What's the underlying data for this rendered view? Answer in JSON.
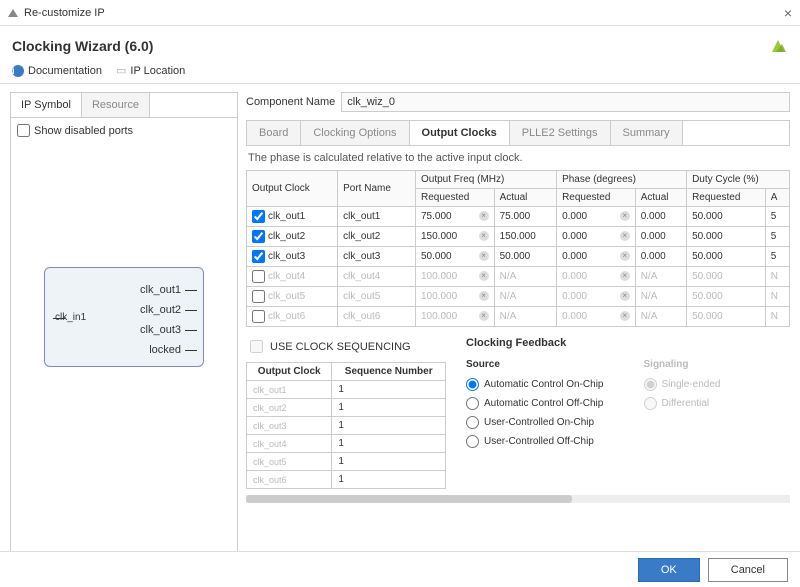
{
  "window_title": "Re-customize IP",
  "page_title": "Clocking Wizard (6.0)",
  "links": {
    "doc": "Documentation",
    "loc": "IP Location"
  },
  "left_tabs": [
    "IP Symbol",
    "Resource"
  ],
  "show_disabled": "Show disabled ports",
  "diagram": {
    "in": "clk_in1",
    "outs": [
      "clk_out1",
      "clk_out2",
      "clk_out3",
      "locked"
    ]
  },
  "comp_label": "Component Name",
  "comp_value": "clk_wiz_0",
  "right_tabs": [
    "Board",
    "Clocking Options",
    "Output Clocks",
    "PLLE2 Settings",
    "Summary"
  ],
  "active_right_tab": 2,
  "note": "The phase is calculated relative to the active input clock.",
  "thead": {
    "oc": "Output Clock",
    "pn": "Port Name",
    "of": "Output Freq (MHz)",
    "ph": "Phase (degrees)",
    "dc": "Duty Cycle (%)",
    "req": "Requested",
    "act": "Actual",
    "a": "A"
  },
  "rows": [
    {
      "en": true,
      "name": "clk_out1",
      "port": "clk_out1",
      "freq_r": "75.000",
      "freq_a": "75.000",
      "ph_r": "0.000",
      "ph_a": "0.000",
      "dc_r": "50.000",
      "dc_a": "5"
    },
    {
      "en": true,
      "name": "clk_out2",
      "port": "clk_out2",
      "freq_r": "150.000",
      "freq_a": "150.000",
      "ph_r": "0.000",
      "ph_a": "0.000",
      "dc_r": "50.000",
      "dc_a": "5"
    },
    {
      "en": true,
      "name": "clk_out3",
      "port": "clk_out3",
      "freq_r": "50.000",
      "freq_a": "50.000",
      "ph_r": "0.000",
      "ph_a": "0.000",
      "dc_r": "50.000",
      "dc_a": "5"
    },
    {
      "en": false,
      "name": "clk_out4",
      "port": "clk_out4",
      "freq_r": "100.000",
      "freq_a": "N/A",
      "ph_r": "0.000",
      "ph_a": "N/A",
      "dc_r": "50.000",
      "dc_a": "N"
    },
    {
      "en": false,
      "name": "clk_out5",
      "port": "clk_out5",
      "freq_r": "100.000",
      "freq_a": "N/A",
      "ph_r": "0.000",
      "ph_a": "N/A",
      "dc_r": "50.000",
      "dc_a": "N"
    },
    {
      "en": false,
      "name": "clk_out6",
      "port": "clk_out6",
      "freq_r": "100.000",
      "freq_a": "N/A",
      "ph_r": "0.000",
      "ph_a": "N/A",
      "dc_r": "50.000",
      "dc_a": "N"
    }
  ],
  "seq_label": "USE CLOCK SEQUENCING",
  "seq_head": {
    "oc": "Output Clock",
    "sn": "Sequence Number"
  },
  "seq_rows": [
    [
      "clk_out1",
      "1"
    ],
    [
      "clk_out2",
      "1"
    ],
    [
      "clk_out3",
      "1"
    ],
    [
      "clk_out4",
      "1"
    ],
    [
      "clk_out5",
      "1"
    ],
    [
      "clk_out6",
      "1"
    ]
  ],
  "fb": {
    "title": "Clocking Feedback",
    "src": "Source",
    "sig": "Signaling",
    "src_opts": [
      "Automatic Control On-Chip",
      "Automatic Control Off-Chip",
      "User-Controlled On-Chip",
      "User-Controlled Off-Chip"
    ],
    "sig_opts": [
      "Single-ended",
      "Differential"
    ]
  },
  "buttons": {
    "ok": "OK",
    "cancel": "Cancel"
  }
}
